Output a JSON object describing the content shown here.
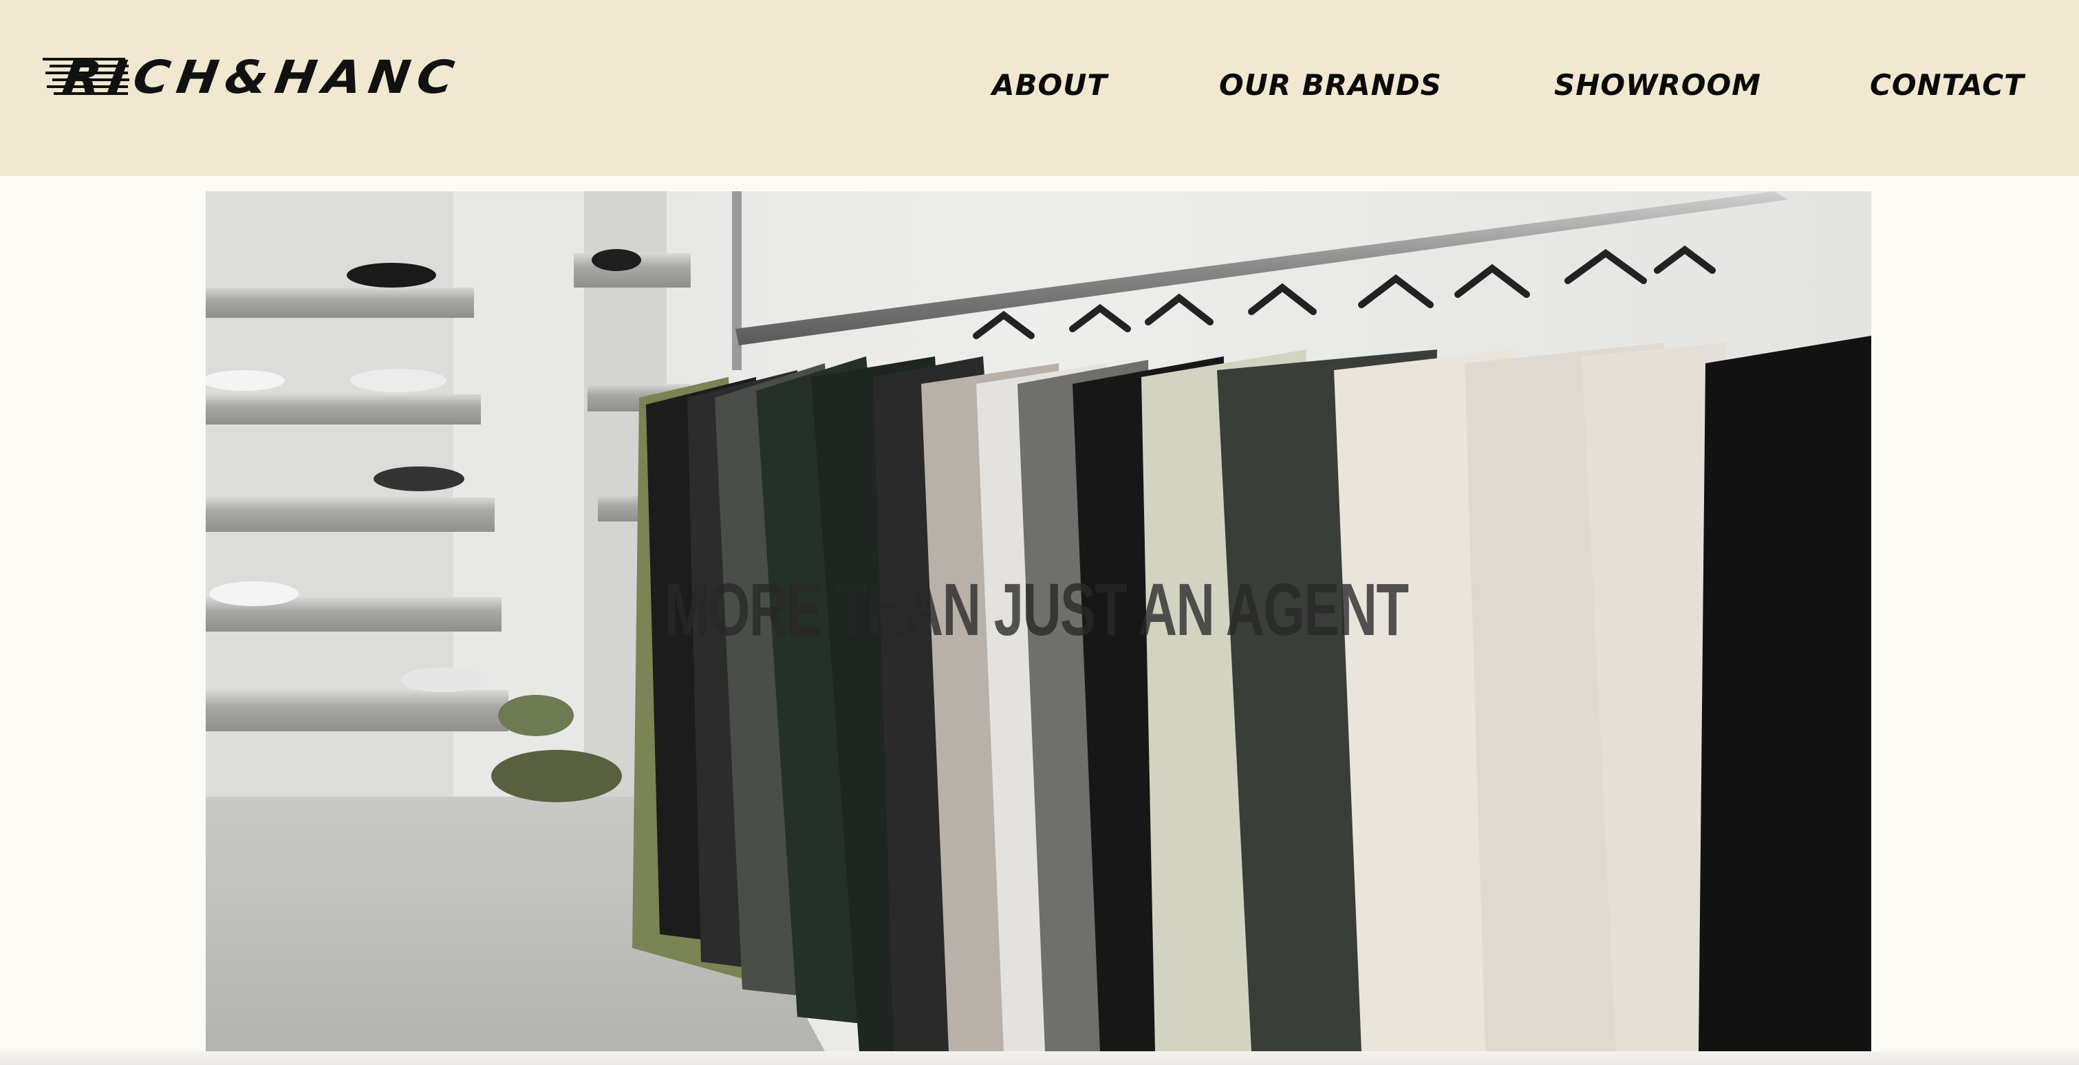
{
  "header": {
    "logo_text": "RICH&HANC"
  },
  "nav": {
    "items": [
      {
        "label": "ABOUT"
      },
      {
        "label": "OUR BRANDS"
      },
      {
        "label": "SHOWROOM"
      },
      {
        "label": "CONTACT"
      }
    ]
  },
  "hero": {
    "headline": "MORE THAN JUST AN AGENT"
  },
  "colors": {
    "header_bg": "#f0e8d0",
    "page_bg": "#fbfaf5",
    "text": "#0a0a0a"
  }
}
